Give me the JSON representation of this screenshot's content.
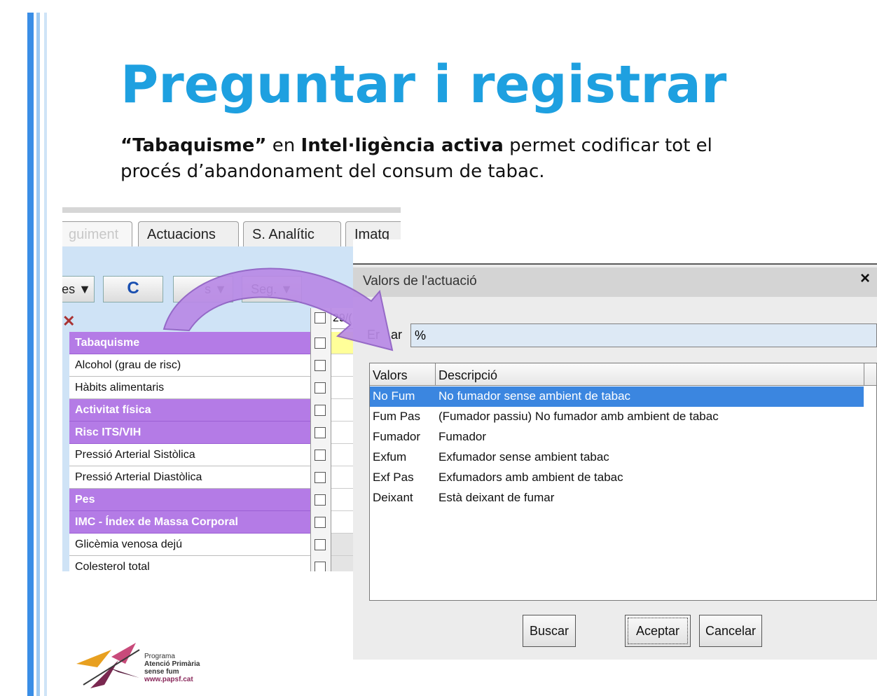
{
  "slide": {
    "title": "Preguntar i registrar",
    "subtitle_bold1": "“Tabaquisme”",
    "subtitle_text1": " en ",
    "subtitle_bold2": "Intel·ligència activa",
    "subtitle_text2": " permet codificar tot el procés d’abandonament del consum de tabac."
  },
  "left_panel": {
    "tabs": [
      "guiment",
      "Actuacions",
      "S. Analític",
      "Imatg"
    ],
    "toolbar": {
      "btn1": "es ▼",
      "refresh": "C",
      "btn3": "s ▼",
      "seg": "Seg. ▼"
    },
    "date_header": "29/(",
    "rows": [
      {
        "label": "Tabaquisme",
        "cat": true
      },
      {
        "label": "Alcohol (grau de risc)",
        "cat": false
      },
      {
        "label": "Hàbits alimentaris",
        "cat": false
      },
      {
        "label": "Activitat física",
        "cat": true
      },
      {
        "label": "Risc ITS/VIH",
        "cat": true
      },
      {
        "label": "Pressió Arterial Sistòlica",
        "cat": false
      },
      {
        "label": "Pressió Arterial Diastòlica",
        "cat": false
      },
      {
        "label": "Pes",
        "cat": true
      },
      {
        "label": "IMC - Índex de Massa Corporal",
        "cat": true
      },
      {
        "label": "Glicèmia venosa dejú",
        "cat": false
      },
      {
        "label": "Colesterol total",
        "cat": false
      }
    ]
  },
  "dialog": {
    "title": "Valors de l'actuació",
    "close": "×",
    "filter_label": "Er",
    "filter_label_2": "ar",
    "filter_value": "%",
    "columns": [
      "Valors",
      "Descripció"
    ],
    "rows": [
      {
        "valor": "No Fum",
        "descripcio": "No fumador sense ambient de tabac",
        "selected": true
      },
      {
        "valor": "Fum Pas",
        "descripcio": "(Fumador passiu) No fumador amb ambient de tabac",
        "selected": false
      },
      {
        "valor": "Fumador",
        "descripcio": "Fumador",
        "selected": false
      },
      {
        "valor": "Exfum",
        "descripcio": "Exfumador sense ambient tabac",
        "selected": false
      },
      {
        "valor": "Exf Pas",
        "descripcio": "Exfumadors amb ambient de tabac",
        "selected": false
      },
      {
        "valor": "Deixant",
        "descripcio": "Està deixant de fumar",
        "selected": false
      }
    ],
    "buttons": {
      "buscar": "Buscar",
      "aceptar": "Aceptar",
      "cancelar": "Cancelar"
    }
  },
  "logo": {
    "line1": "Programa",
    "line2": "Atenció Primària",
    "line3": "sense fum",
    "url": "www.papsf.cat"
  },
  "colors": {
    "title": "#1ea0e0",
    "category_row": "#b47be6",
    "selected_row": "#3b86e0",
    "arrow": "#b98ae6"
  }
}
